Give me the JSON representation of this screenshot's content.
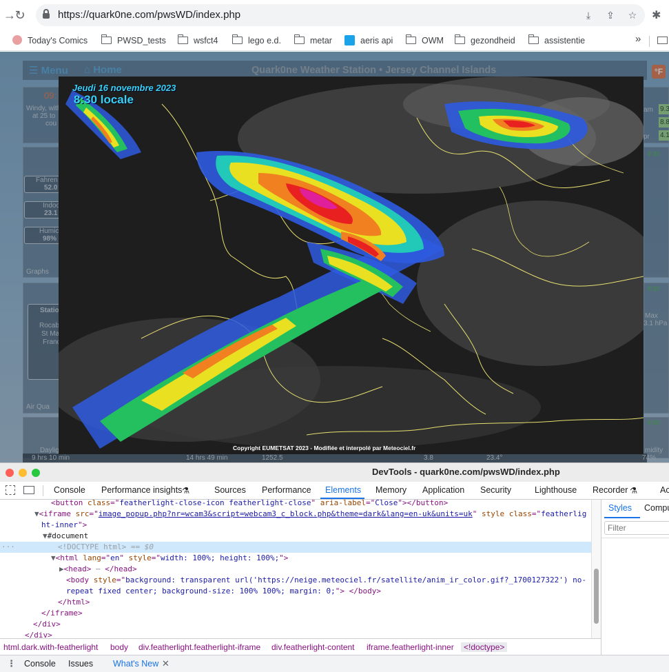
{
  "browser": {
    "url": "https://quark0ne.com/pwsWD/index.php",
    "bookmarks": [
      "Today's Comics",
      "PWSD_tests",
      "wsfct4",
      "lego e.d.",
      "metar",
      "aeris api",
      "OWM",
      "gezondheid",
      "assistentie"
    ],
    "more": "»"
  },
  "site": {
    "menu": "☰ Menu",
    "home": "⌂ Home",
    "title": "Quark0ne Weather Station  •  Jersey Channel Islands",
    "unit": "°F",
    "left_time": "09:",
    "left_desc": [
      "Windy, with",
      "at 25 to",
      "cou"
    ],
    "fahrenheit_label": "Fahren",
    "fahrenheit_value": "52.0",
    "indoor_label": "Indoo",
    "indoor_value": "23.1",
    "humidity_label": "Humic",
    "humidity_value": "98%",
    "graphs": "Graphs",
    "station_label": "Statio",
    "station_lines": [
      "Rocab",
      "St Ma",
      "Franc"
    ],
    "air_quality": "Air Qua",
    "right_am": "am",
    "right_pr": "pr",
    "right_values": [
      "9.3",
      "8.8",
      "4.1"
    ],
    "right_time1": "8:30",
    "right_time2": "8:30",
    "right_time3": "8:30",
    "right_max": "Max",
    "right_hpa": "3.1 hPa",
    "daylight_label": "Dayligh",
    "daylight_value": "9 hrs 10 min",
    "humidity_right": "midity",
    "strip_values": [
      "14 hrs 49 min",
      "1252.5",
      "3.8",
      "23.4°",
      "74%"
    ]
  },
  "satellite": {
    "date": "Jeudi 16 novembre 2023",
    "time": "8:30 locale",
    "copyright": "Copyright EUMETSAT 2023 - Modifiée et interpolé par Meteociel.fr"
  },
  "devtools": {
    "window_title": "DevTools - quark0ne.com/pwsWD/index.php",
    "tabs": [
      "Console",
      "Performance insights",
      "Sources",
      "Performance",
      "Elements",
      "Memory",
      "Application",
      "Security",
      "Lighthouse",
      "Recorder",
      "Ac"
    ],
    "active_tab": "Elements",
    "code": {
      "button_line_class": "featherlight-close-icon featherlight-close",
      "button_line_label": "Close",
      "iframe_src": "image_popup.php?nr=wcam3&script=webcam3_c_block.php&theme=dark&lang=en-uk&units=uk",
      "iframe_class": "featherlig",
      "iframe_class_cont": "ht-inner",
      "document": "#document",
      "doctype": "<!DOCTYPE html>",
      "doctype_suffix": "== $0",
      "html_lang": "en",
      "html_style": "width: 100%; height: 100%;",
      "body_style_1": "background: transparent url('https://neige.meteociel.fr/satellite/anim_ir_color.gif?_1700127322') no-",
      "body_style_2": "repeat fixed center;  background-size: 100% 100%; margin:  0;"
    },
    "styles_tabs": [
      "Styles",
      "Compu"
    ],
    "filter_placeholder": "Filter",
    "breadcrumbs": [
      "html.dark.with-featherlight",
      "body",
      "div.featherlight.featherlight-iframe",
      "div.featherlight-content",
      "iframe.featherlight-inner",
      "<!doctype>"
    ],
    "drawer_tabs": [
      "Console",
      "Issues",
      "What's New"
    ]
  }
}
